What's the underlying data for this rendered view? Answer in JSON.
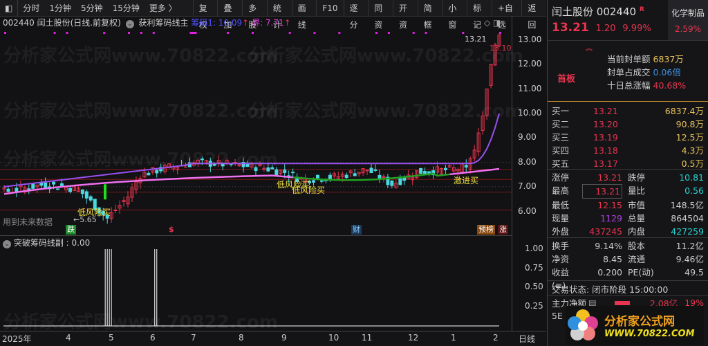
{
  "toolbar": {
    "periods": [
      "分时",
      "1分钟",
      "5分钟",
      "15分钟",
      "更多 〉"
    ],
    "buttons": [
      "复权",
      "叠加",
      "多股",
      "统计",
      "画线",
      "F10",
      "逐分",
      "同资",
      "开资",
      "简框",
      "小窗",
      "标记",
      "+自选",
      "返回"
    ]
  },
  "info": {
    "code_name": "002440 闰土股份(日线.前复权)",
    "indicator": "获利筹码线主",
    "chip1": "筹码1: 10.09",
    "bound": "界: 7.71",
    "arrow": "↑"
  },
  "chart_data": {
    "type": "candlestick",
    "title": "002440 闰土股份 日线",
    "ylim": [
      5.4,
      13.4
    ],
    "yticks": [
      "13.00",
      "12.00",
      "11.00",
      "10.00",
      "9.00",
      "8.00",
      "7.00",
      "6.00"
    ],
    "xticks": [
      "2025年",
      "4",
      "5",
      "6",
      "7",
      "8",
      "9",
      "10",
      "11",
      "12",
      "1",
      "2"
    ],
    "anchors": [
      [
        0,
        6.8
      ],
      [
        10,
        7.1
      ],
      [
        18,
        6.9
      ],
      [
        22,
        6.2
      ],
      [
        25,
        5.7
      ],
      [
        30,
        6.6
      ],
      [
        33,
        7.5
      ],
      [
        40,
        7.8
      ],
      [
        47,
        8.0
      ],
      [
        55,
        7.9
      ],
      [
        62,
        7.8
      ],
      [
        68,
        7.6
      ],
      [
        72,
        7.3
      ],
      [
        80,
        7.4
      ],
      [
        88,
        7.7
      ],
      [
        94,
        7.1
      ],
      [
        100,
        7.6
      ],
      [
        108,
        7.7
      ],
      [
        112,
        7.8
      ],
      [
        114,
        8.5
      ],
      [
        116,
        9.9
      ],
      [
        117,
        11.0
      ],
      [
        118,
        12.0
      ],
      [
        119,
        12.8
      ],
      [
        120,
        13.21
      ]
    ],
    "high_label": "13.21",
    "high_label2": "13.10",
    "low_label": "←5.65",
    "future_note": "用到未来数据",
    "signals": [
      "低风险买",
      "低风险买",
      "低风险买",
      "激进买"
    ],
    "markers": {
      "die": "跌",
      "s": "$",
      "cai": "财",
      "yubang": "预榜",
      "zhang": "涨"
    },
    "sub": {
      "title": "突破筹码线副 : 0.00",
      "yticks": [
        "1.00",
        "0.75",
        "0.50",
        "0.25"
      ],
      "spikes": [
        25,
        26,
        37
      ]
    },
    "period_label": "日线"
  },
  "panel": {
    "name": "闰土股份",
    "code": "002440",
    "r": "R",
    "sector": "化学制品",
    "sector_pct": "2.59%",
    "price": "13.21",
    "change": "1.20",
    "pct": "9.99%",
    "board": "首板",
    "seal_amt_label": "当前封单额",
    "seal_amt": "6837万",
    "seal_ratio_label": "封单占成交",
    "seal_ratio": "0.06倍",
    "ten_day_label": "十日总涨幅",
    "ten_day": "40.68%",
    "bids": [
      {
        "l": "买一",
        "p": "13.21",
        "v": "6837.4万"
      },
      {
        "l": "买二",
        "p": "13.20",
        "v": "90.8万"
      },
      {
        "l": "买三",
        "p": "13.19",
        "v": "12.5万"
      },
      {
        "l": "买四",
        "p": "13.18",
        "v": "4.3万"
      },
      {
        "l": "买五",
        "p": "13.17",
        "v": "0.5万"
      }
    ],
    "stats": [
      [
        "涨停",
        "13.21",
        "跌停",
        "10.81"
      ],
      [
        "最高",
        "13.21",
        "量比",
        "0.56"
      ],
      [
        "最低",
        "12.15",
        "市值",
        "148.5亿"
      ],
      [
        "现量",
        "1129",
        "总量",
        "864504"
      ],
      [
        "外盘",
        "437245",
        "内盘",
        "427259"
      ]
    ],
    "stats2": [
      [
        "换手",
        "9.14%",
        "股本",
        "11.2亿"
      ],
      [
        "净资",
        "8.45",
        "流通",
        "9.46亿"
      ],
      [
        "收益(≡)",
        "0.200",
        "PE(动)",
        "49.5"
      ]
    ],
    "status": "交易状态: 闭市阶段 15:00:00",
    "main_label": "主力净额",
    "main_amt": "2.08亿",
    "main_pct": "19%",
    "row5": "5E",
    "logo_text": "分析家公式网",
    "logo_url": "WWW.70822.COM"
  },
  "watermark": "分析家公式网www.70822.com"
}
